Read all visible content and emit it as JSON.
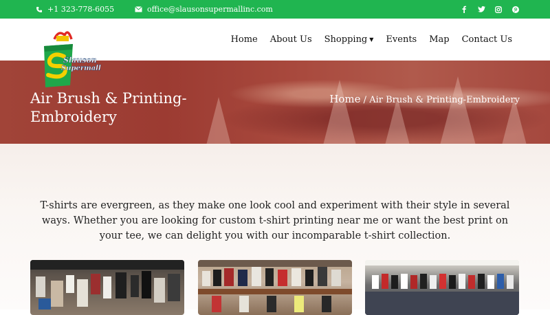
{
  "topbar": {
    "phone": "+1 323-778-6055",
    "email": "office@slausonsupermallinc.com",
    "social": [
      "facebook-icon",
      "twitter-icon",
      "instagram-icon",
      "pinterest-icon"
    ]
  },
  "logo": {
    "line1": "Slauson",
    "line2": "Supermall"
  },
  "menu": {
    "items": [
      {
        "label": "Home"
      },
      {
        "label": "About Us"
      },
      {
        "label": "Shopping"
      },
      {
        "label": "Events"
      },
      {
        "label": "Map"
      },
      {
        "label": "Contact Us"
      }
    ]
  },
  "hero": {
    "title": "Air Brush & Printing-Embroidery",
    "breadcrumb_home": "Home",
    "breadcrumb_separator": "/",
    "breadcrumb_current": "Air Brush & Printing-Embroidery"
  },
  "main": {
    "intro": "T-shirts are evergreen, as they make one look cool and experiment with their style in several ways. Whether you are looking for custom t-shirt printing near me or want the best print on your tee, we can delight you with our incomparable t-shirt collection."
  },
  "colors": {
    "topbar": "#20b550",
    "hero": "#a14438",
    "logo_bag": "#1fa84a"
  }
}
